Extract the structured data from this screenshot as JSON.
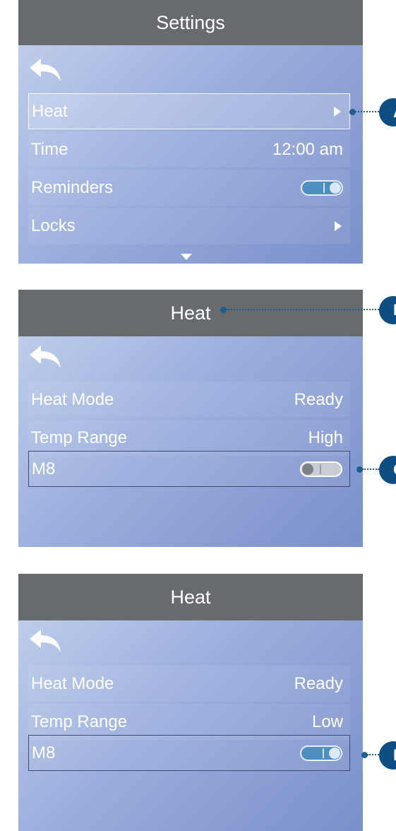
{
  "panel1": {
    "title": "Settings",
    "rows": [
      {
        "label": "Heat",
        "value": ""
      },
      {
        "label": "Time",
        "value": "12:00 am"
      },
      {
        "label": "Reminders",
        "value": ""
      },
      {
        "label": "Locks",
        "value": ""
      }
    ],
    "reminders_toggle": "on"
  },
  "panel2": {
    "title": "Heat",
    "rows": [
      {
        "label": "Heat Mode",
        "value": "Ready"
      },
      {
        "label": "Temp Range",
        "value": "High"
      },
      {
        "label": "M8",
        "value": ""
      }
    ],
    "m8_toggle": "off"
  },
  "panel3": {
    "title": "Heat",
    "rows": [
      {
        "label": "Heat Mode",
        "value": "Ready"
      },
      {
        "label": "Temp Range",
        "value": "Low"
      },
      {
        "label": "M8",
        "value": ""
      }
    ],
    "m8_toggle": "on"
  },
  "callouts": [
    "A",
    "B",
    "C",
    "D"
  ],
  "colors": {
    "titlebar": "#676b6e",
    "callout": "#0e4e83",
    "toggle_on": "#4f8fbf",
    "toggle_off": "#c9ccd2"
  },
  "icons": [
    "back-arrow-icon",
    "chevron-right-icon",
    "scroll-down-icon"
  ]
}
